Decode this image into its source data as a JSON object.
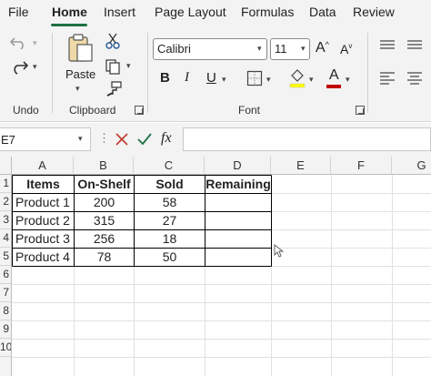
{
  "menu": [
    "File",
    "Home",
    "Insert",
    "Page Layout",
    "Formulas",
    "Data",
    "Review"
  ],
  "ribbon": {
    "groups": {
      "undo": "Undo",
      "clipboard": "Clipboard",
      "font": "Font"
    },
    "paste_label": "Paste",
    "font_name": "Calibri",
    "font_size": "11",
    "bold": "B",
    "italic": "I",
    "underline": "U",
    "grow_font": "A",
    "shrink_font": "A",
    "font_color_letter": "A",
    "font_color": "#c00000"
  },
  "formula_bar": {
    "name_box": "E7",
    "fx": "fx",
    "formula": ""
  },
  "sheet": {
    "columns": [
      "A",
      "B",
      "C",
      "D",
      "E",
      "F",
      "G"
    ],
    "rows": [
      "1",
      "2",
      "3",
      "4",
      "5",
      "6",
      "7",
      "8",
      "9",
      "10"
    ],
    "table": {
      "headers": [
        "Items",
        "On-Shelf",
        "Sold",
        "Remaining"
      ],
      "rows": [
        [
          "Product 1",
          "200",
          "58",
          ""
        ],
        [
          "Product 2",
          "315",
          "27",
          ""
        ],
        [
          "Product 3",
          "256",
          "18",
          ""
        ],
        [
          "Product 4",
          "78",
          "50",
          ""
        ]
      ]
    }
  },
  "accent": "#1e7145"
}
